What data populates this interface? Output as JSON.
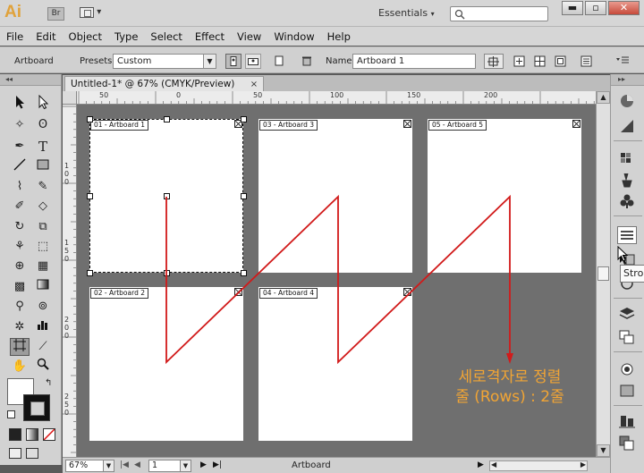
{
  "titlebar": {
    "app_logo": "Ai",
    "bridge_label": "Br",
    "workspace": "Essentials",
    "colors": {
      "logo": "#e0a23b",
      "close": "#c74a3a"
    }
  },
  "menu": [
    "File",
    "Edit",
    "Object",
    "Type",
    "Select",
    "Effect",
    "View",
    "Window",
    "Help"
  ],
  "controlbar": {
    "tool_label": "Artboard",
    "presets_label": "Presets:",
    "presets_value": "Custom",
    "name_label": "Name:",
    "name_value": "Artboard 1"
  },
  "document": {
    "tab_title": "Untitled-1* @ 67% (CMYK/Preview)",
    "tab_close": "×"
  },
  "rulers": {
    "h_labels": [
      "50",
      "0",
      "50",
      "100",
      "150",
      "200"
    ],
    "v_labels": [
      "1\n0\n0",
      "1\n5\n0",
      "2\n0\n0",
      "2\n5\n0"
    ]
  },
  "artboards": [
    {
      "label": "01 - Artboard 1"
    },
    {
      "label": "02 - Artboard 2"
    },
    {
      "label": "03 - Artboard 3"
    },
    {
      "label": "04 - Artboard 4"
    },
    {
      "label": "05 - Artboard 5"
    }
  ],
  "annotation": {
    "line1": "세로격자로 정렬",
    "line2": "줄 (Rows) : 2줄",
    "color": "#f2a534",
    "path_color": "#d11a1a"
  },
  "statusbar": {
    "zoom": "67%",
    "page": "1",
    "status": "Artboard"
  },
  "tooltip": "Stro",
  "icons": [
    "selection-tool",
    "direct-selection-tool",
    "magic-wand-tool",
    "lasso-tool",
    "pen-tool",
    "type-tool",
    "line-tool",
    "rectangle-tool",
    "paintbrush-tool",
    "pencil-tool",
    "blob-brush-tool",
    "eraser-tool",
    "rotate-tool",
    "scale-tool",
    "width-tool",
    "free-transform-tool",
    "shape-builder-tool",
    "perspective-tool",
    "mesh-tool",
    "gradient-tool",
    "eyedropper-tool",
    "blend-tool",
    "symbol-sprayer-tool",
    "column-graph-tool",
    "artboard-tool",
    "slice-tool",
    "hand-tool",
    "zoom-tool"
  ]
}
